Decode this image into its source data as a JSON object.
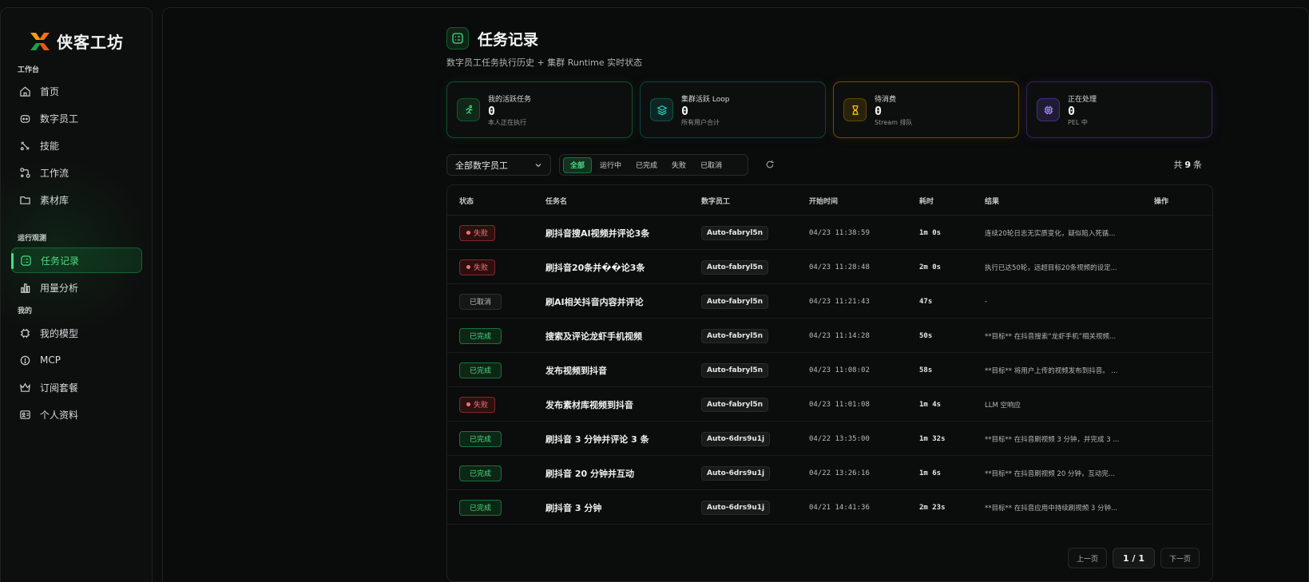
{
  "brand": {
    "name": "侠客工坊"
  },
  "sidebar": {
    "sections": [
      {
        "label": "工作台"
      },
      {
        "label": "运行观测"
      },
      {
        "label": "我的"
      }
    ],
    "items": [
      {
        "label": "首页",
        "icon": "home-icon"
      },
      {
        "label": "数字员工",
        "icon": "bot-icon"
      },
      {
        "label": "技能",
        "icon": "tools-icon"
      },
      {
        "label": "工作流",
        "icon": "workflow-icon"
      },
      {
        "label": "素材库",
        "icon": "folder-icon"
      },
      {
        "label": "任务记录",
        "icon": "task-list-icon",
        "active": true
      },
      {
        "label": "用量分析",
        "icon": "bar-chart-icon"
      },
      {
        "label": "我的模型",
        "icon": "chip-icon"
      },
      {
        "label": "MCP",
        "icon": "plug-icon"
      },
      {
        "label": "订阅套餐",
        "icon": "crown-icon"
      },
      {
        "label": "个人资料",
        "icon": "id-card-icon"
      }
    ]
  },
  "header": {
    "title": "任务记录",
    "subtitle": "数字员工任务执行历史 + 集群 Runtime 实时状态"
  },
  "stats": [
    {
      "label": "我的活跃任务",
      "value": "0",
      "sub": "本人正在执行",
      "color": "#22c55e",
      "icon": "running-icon"
    },
    {
      "label": "集群活跃 Loop",
      "value": "0",
      "sub": "所有用户合计",
      "color": "#14b8a6",
      "icon": "layers-icon"
    },
    {
      "label": "待消费",
      "value": "0",
      "sub": "Stream 排队",
      "color": "#ca8a04",
      "icon": "hourglass-icon"
    },
    {
      "label": "正在处理",
      "value": "0",
      "sub": "PEL 中",
      "color": "#8b5cf6",
      "icon": "cpu-icon"
    }
  ],
  "filters": {
    "agent_select": "全部数字员工",
    "tabs": [
      "全部",
      "运行中",
      "已完成",
      "失败",
      "已取消"
    ],
    "active_tab": "全部",
    "total_prefix": "共",
    "total_count": "9",
    "total_suffix": "条"
  },
  "table": {
    "columns": [
      "状态",
      "任务名",
      "数字员工",
      "开始时间",
      "耗时",
      "结果",
      "操作"
    ],
    "rows": [
      {
        "status": "失败",
        "status_type": "failed",
        "name": "刷抖音搜AI视频并评论3条",
        "agent": "Auto-fabryl5n",
        "start": "04/23 11:38:59",
        "duration": "1m 0s",
        "result": "连续20轮日志无实质变化，疑似陷入死循..."
      },
      {
        "status": "失败",
        "status_type": "failed",
        "name": "刷抖音20条并��论3条",
        "agent": "Auto-fabryl5n",
        "start": "04/23 11:28:48",
        "duration": "2m 0s",
        "result": "执行已达50轮，远超目标20条视频的设定..."
      },
      {
        "status": "已取消",
        "status_type": "cancel",
        "name": "刷AI相关抖音内容并评论",
        "agent": "Auto-fabryl5n",
        "start": "04/23 11:21:43",
        "duration": "47s",
        "result": "-"
      },
      {
        "status": "已完成",
        "status_type": "done",
        "name": "搜索及评论龙虾手机视频",
        "agent": "Auto-fabryl5n",
        "start": "04/23 11:14:28",
        "duration": "50s",
        "result": "**目标** 在抖音搜索“龙虾手机”相关视频..."
      },
      {
        "status": "已完成",
        "status_type": "done",
        "name": "发布视频到抖音",
        "agent": "Auto-fabryl5n",
        "start": "04/23 11:08:02",
        "duration": "58s",
        "result": "**目标** 将用户上传的视频发布到抖音。 ..."
      },
      {
        "status": "失败",
        "status_type": "failed",
        "name": "发布素材库视频到抖音",
        "agent": "Auto-fabryl5n",
        "start": "04/23 11:01:08",
        "duration": "1m 4s",
        "result": "LLM 空响应"
      },
      {
        "status": "已完成",
        "status_type": "done",
        "name": "刷抖音 3 分钟并评论 3 条",
        "agent": "Auto-6drs9u1j",
        "start": "04/22 13:35:00",
        "duration": "1m 32s",
        "result": "**目标** 在抖音刷视频 3 分钟，并完成 3 ..."
      },
      {
        "status": "已完成",
        "status_type": "done",
        "name": "刷抖音 20 分钟并互动",
        "agent": "Auto-6drs9u1j",
        "start": "04/22 13:26:16",
        "duration": "1m 6s",
        "result": "**目标** 在抖音刷视频 20 分钟，互动完..."
      },
      {
        "status": "已完成",
        "status_type": "done",
        "name": "刷抖音 3 分钟",
        "agent": "Auto-6drs9u1j",
        "start": "04/21 14:41:36",
        "duration": "2m 23s",
        "result": "**目标** 在抖音应用中持续刷视频 3 分钟..."
      }
    ]
  },
  "pagination": {
    "prev": "上一页",
    "current": "1 / 1",
    "next": "下一页"
  }
}
